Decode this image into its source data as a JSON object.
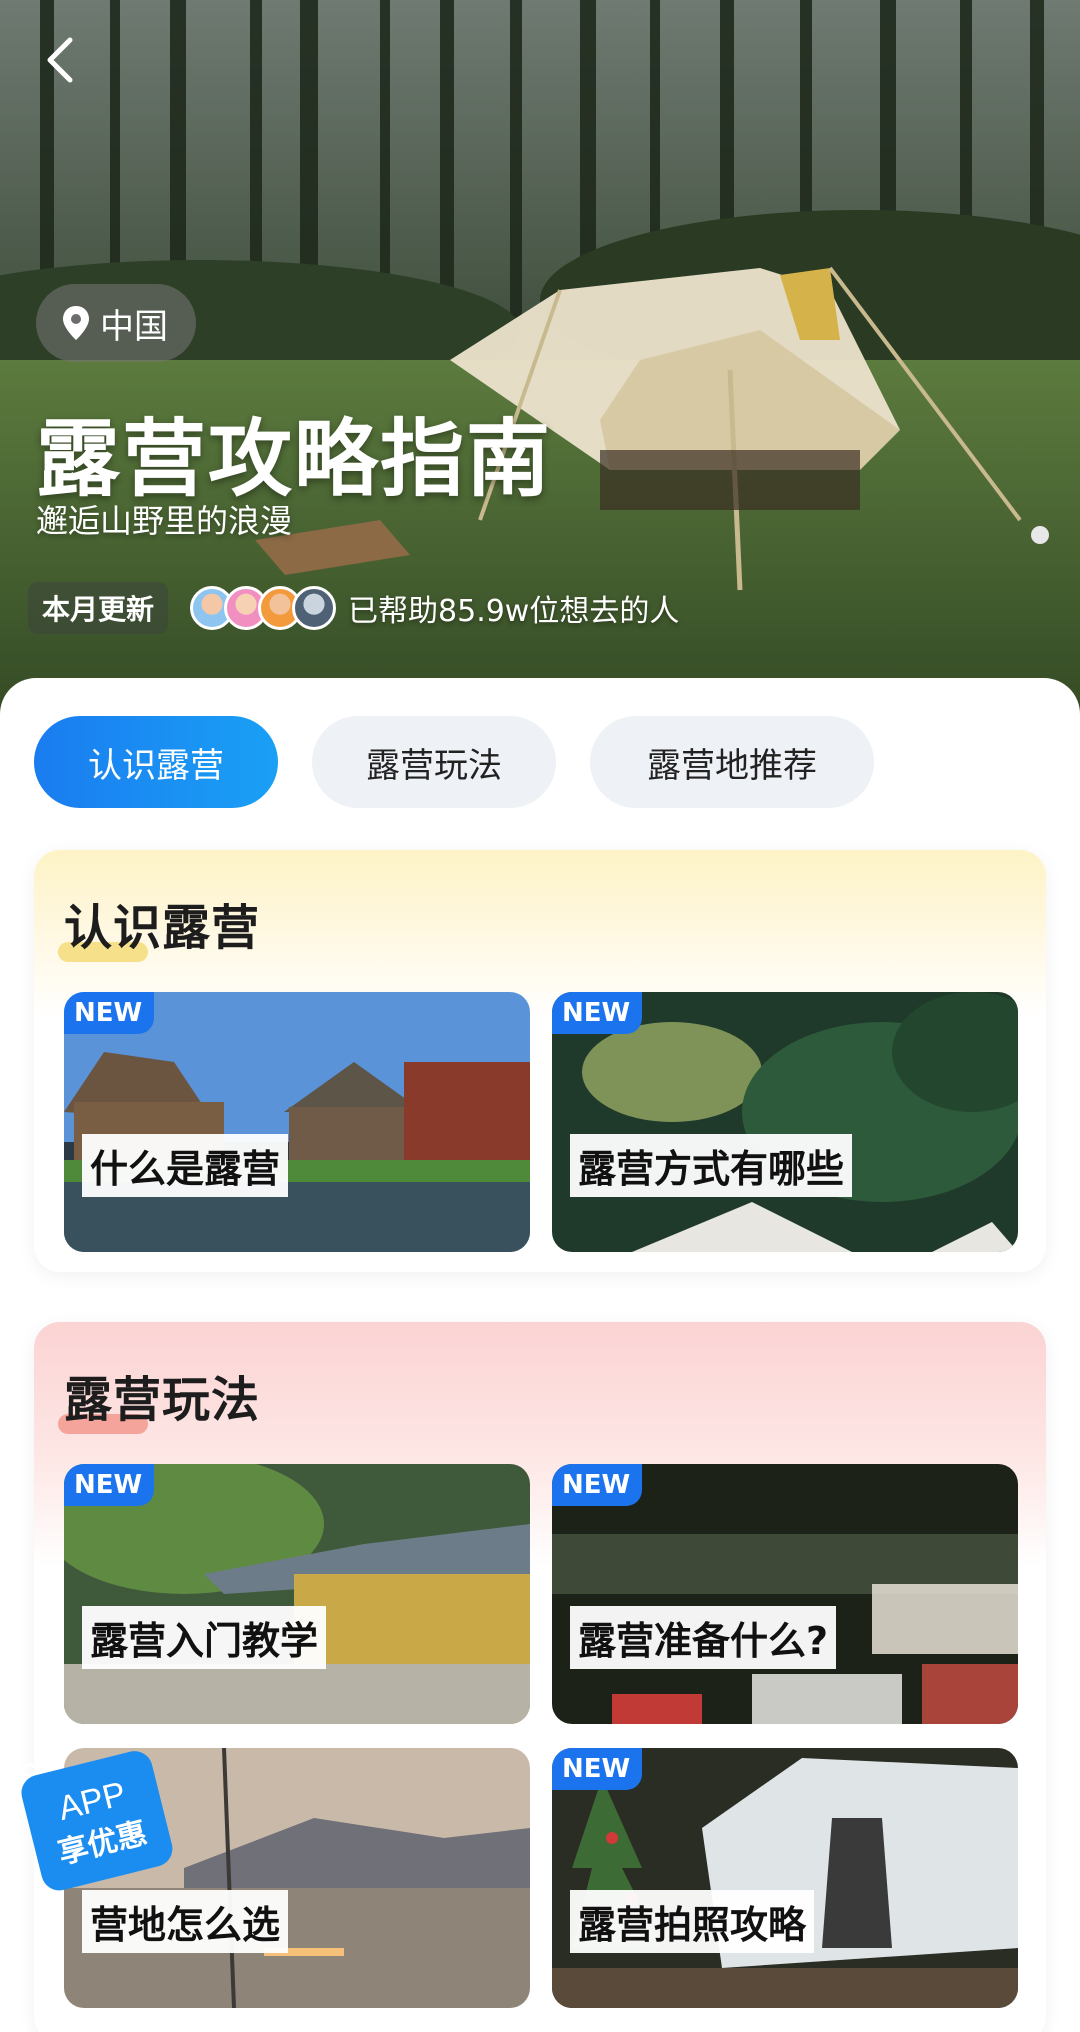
{
  "hero": {
    "location": "中国",
    "title": "露营攻略指南",
    "subtitle": "邂逅山野里的浪漫",
    "update_tag": "本月更新",
    "helped_text": "已帮助85.9w位想去的人"
  },
  "tabs": [
    {
      "label": "认识露营",
      "active": true
    },
    {
      "label": "露营玩法",
      "active": false
    },
    {
      "label": "露营地推荐",
      "active": false
    }
  ],
  "sections": [
    {
      "title": "认识露营",
      "cards": [
        {
          "badge": "NEW",
          "label": "什么是露营"
        },
        {
          "badge": "NEW",
          "label": "露营方式有哪些"
        }
      ]
    },
    {
      "title": "露营玩法",
      "cards": [
        {
          "badge": "NEW",
          "label": "露营入门教学"
        },
        {
          "badge": "NEW",
          "label": "露营准备什么?"
        },
        {
          "badge": "",
          "label": "营地怎么选"
        },
        {
          "badge": "NEW",
          "label": "露营拍照攻略"
        }
      ]
    }
  ],
  "promo": {
    "line1": "APP",
    "line2": "享优惠"
  },
  "colors": {
    "accent": "#1a7cf0",
    "badge": "#1b74ee",
    "tab_inactive": "#eef1f6"
  }
}
